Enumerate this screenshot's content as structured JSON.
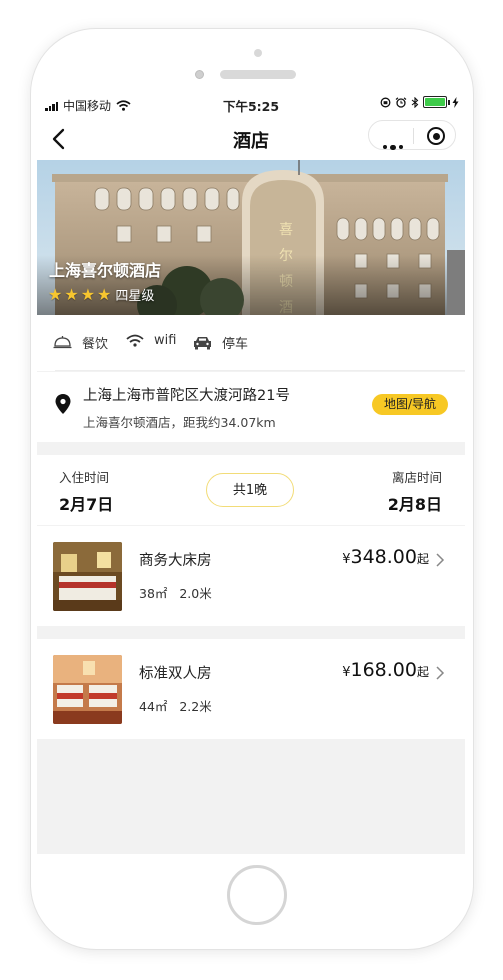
{
  "statusbar": {
    "carrier": "中国移动",
    "time": "下午5:25"
  },
  "navbar": {
    "title": "酒店"
  },
  "hotel": {
    "name": "上海喜尔顿酒店",
    "stars": 4,
    "level": "四星级"
  },
  "amenities": [
    {
      "label": "餐饮",
      "icon": "dining-bell-icon"
    },
    {
      "label": "wifi",
      "icon": "wifi-icon"
    },
    {
      "label": "停车",
      "icon": "car-icon"
    }
  ],
  "address": {
    "line": "上海上海市普陀区大渡河路21号",
    "distance": "上海喜尔顿酒店，距我约34.07km",
    "map_button": "地图/导航"
  },
  "stay": {
    "checkin_label": "入住时间",
    "checkin_date": "2月7日",
    "nights": "共1晚",
    "checkout_label": "离店时间",
    "checkout_date": "2月8日"
  },
  "rooms": [
    {
      "name": "商务大床房",
      "area": "38㎡",
      "bed": "2.0米",
      "currency": "¥",
      "price": "348.00",
      "suffix": "起"
    },
    {
      "name": "标准双人房",
      "area": "44㎡",
      "bed": "2.2米",
      "currency": "¥",
      "price": "168.00",
      "suffix": "起"
    }
  ],
  "colors": {
    "accent": "#f7c824",
    "page_bg": "#f2f2f2",
    "star": "#f7c62f"
  }
}
